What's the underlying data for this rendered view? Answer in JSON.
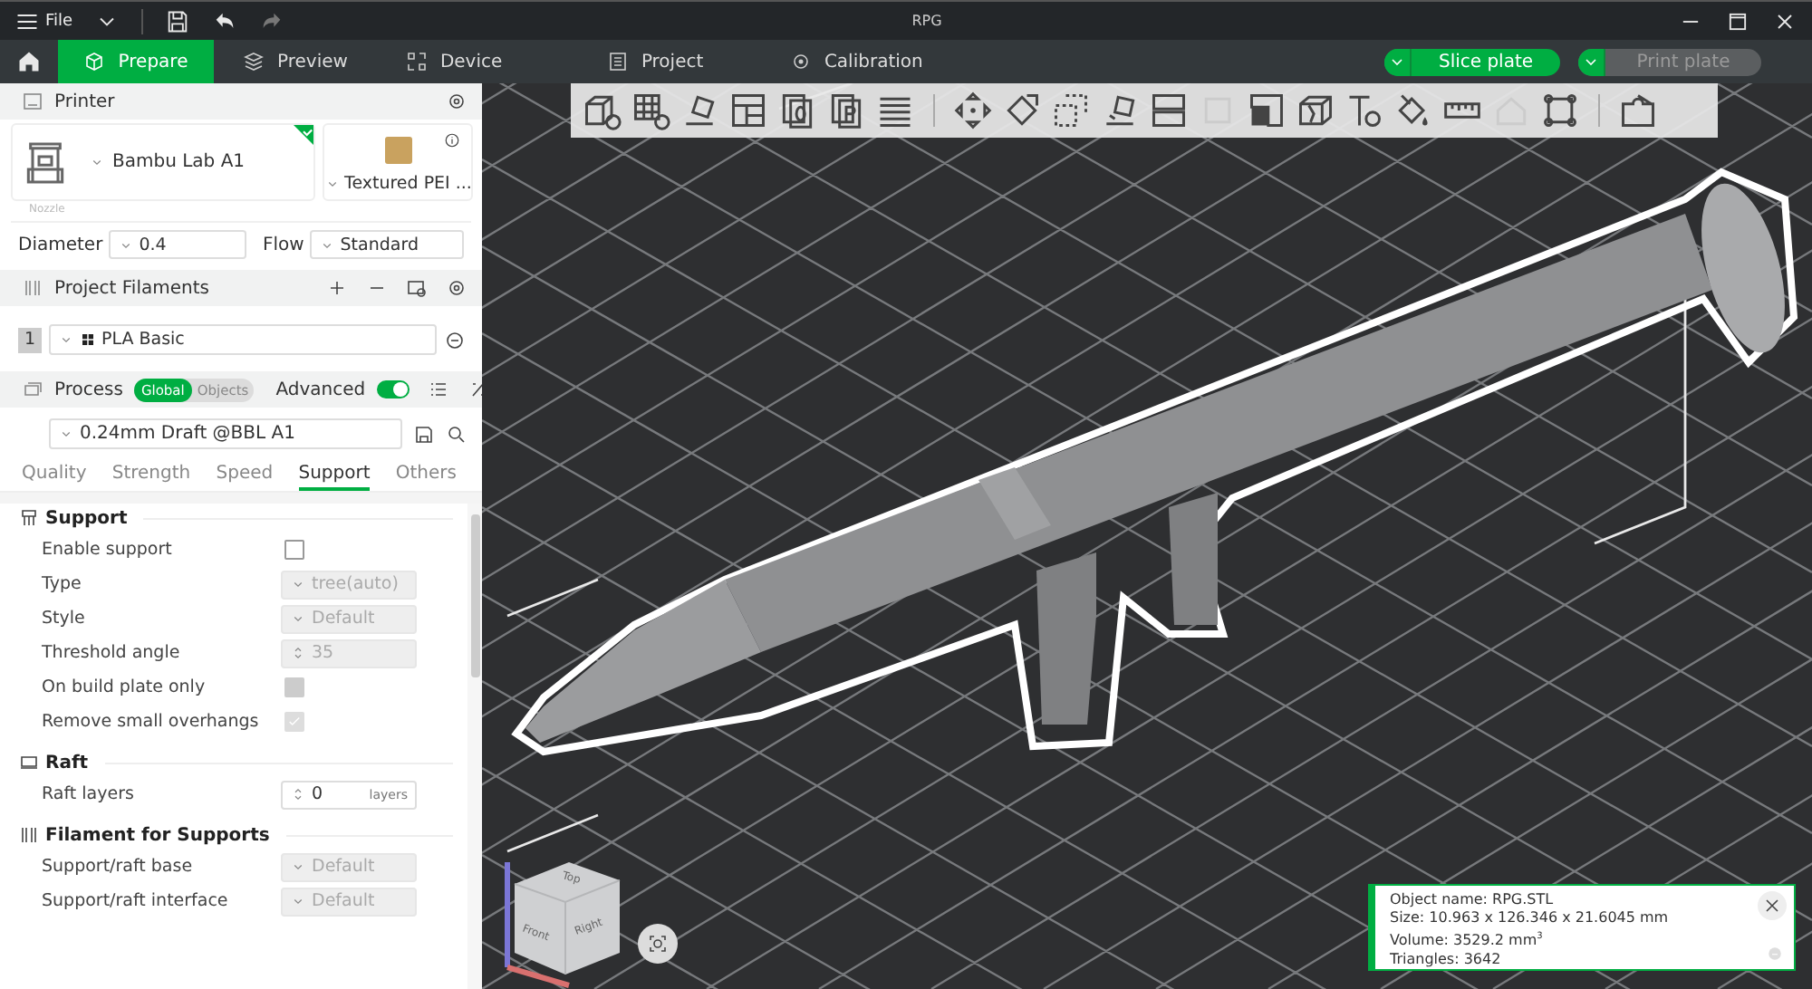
{
  "window": {
    "title": "RPG",
    "menu": "File"
  },
  "tabs": [
    {
      "label": "Prepare",
      "selected": true
    },
    {
      "label": "Preview",
      "selected": false
    },
    {
      "label": "Device",
      "selected": false
    },
    {
      "label": "Project",
      "selected": false
    },
    {
      "label": "Calibration",
      "selected": false
    }
  ],
  "actions": [
    {
      "label": "Slice plate",
      "disabled": false
    },
    {
      "label": "Print plate",
      "disabled": true
    }
  ],
  "printer": {
    "title": "Printer",
    "name": "Bambu Lab A1",
    "plate": "Textured PEI ...",
    "nozzle_label": "Nozzle",
    "diameter_label": "Diameter",
    "diameter": "0.4",
    "flow_label": "Flow",
    "flow": "Standard"
  },
  "filaments": {
    "title": "Project Filaments",
    "items": [
      {
        "index": "1",
        "name": "PLA Basic"
      }
    ]
  },
  "process": {
    "title": "Process",
    "scopes": [
      {
        "label": "Global",
        "selected": true
      },
      {
        "label": "Objects",
        "selected": false
      }
    ],
    "advanced_label": "Advanced",
    "advanced": true,
    "preset": "0.24mm Draft @BBL A1",
    "tabs": [
      {
        "label": "Quality",
        "selected": false
      },
      {
        "label": "Strength",
        "selected": false
      },
      {
        "label": "Speed",
        "selected": false
      },
      {
        "label": "Support",
        "selected": true
      },
      {
        "label": "Others",
        "selected": false
      }
    ]
  },
  "settings": [
    {
      "title": "Support",
      "rows": [
        {
          "label": "Enable support",
          "kind": "checkbox",
          "checked": false,
          "disabled": false
        },
        {
          "label": "Type",
          "kind": "select",
          "value": "tree(auto)",
          "disabled": true
        },
        {
          "label": "Style",
          "kind": "select",
          "value": "Default",
          "disabled": true
        },
        {
          "label": "Threshold angle",
          "kind": "spin",
          "value": "35",
          "disabled": true
        },
        {
          "label": "On build plate only",
          "kind": "checkbox",
          "checked": false,
          "disabled": true
        },
        {
          "label": "Remove small overhangs",
          "kind": "checkbox",
          "checked": true,
          "disabled": true
        }
      ]
    },
    {
      "title": "Raft",
      "rows": [
        {
          "label": "Raft layers",
          "kind": "spin",
          "value": "0",
          "unit": "layers",
          "disabled": false
        }
      ]
    },
    {
      "title": "Filament for Supports",
      "rows": [
        {
          "label": "Support/raft base",
          "kind": "select",
          "value": "Default",
          "disabled": true
        },
        {
          "label": "Support/raft interface",
          "kind": "select",
          "value": "Default",
          "disabled": true
        }
      ]
    }
  ],
  "toolbar": [
    [
      {
        "disabled": false
      },
      {
        "disabled": false
      },
      {
        "disabled": false
      },
      {
        "disabled": false
      },
      {
        "disabled": false
      },
      {
        "disabled": false
      },
      {
        "disabled": false
      }
    ],
    [
      {
        "disabled": false
      },
      {
        "disabled": false
      },
      {
        "disabled": false
      },
      {
        "disabled": false
      },
      {
        "disabled": false
      },
      {
        "disabled": true
      },
      {
        "disabled": false
      },
      {
        "disabled": false
      },
      {
        "disabled": false
      },
      {
        "disabled": false
      },
      {
        "disabled": false
      },
      {
        "disabled": true
      },
      {
        "disabled": false
      }
    ],
    [
      {
        "disabled": false
      }
    ]
  ],
  "view_cube": {
    "top": "Top",
    "front": "Front",
    "right": "Right"
  },
  "object_info": {
    "lines": [
      "Object name: RPG.STL",
      "Size: 10.963 x 126.346 x 21.6045 mm",
      "Volume: 3529.2 mm$^{3}$",
      "Triangles: 3642"
    ]
  }
}
